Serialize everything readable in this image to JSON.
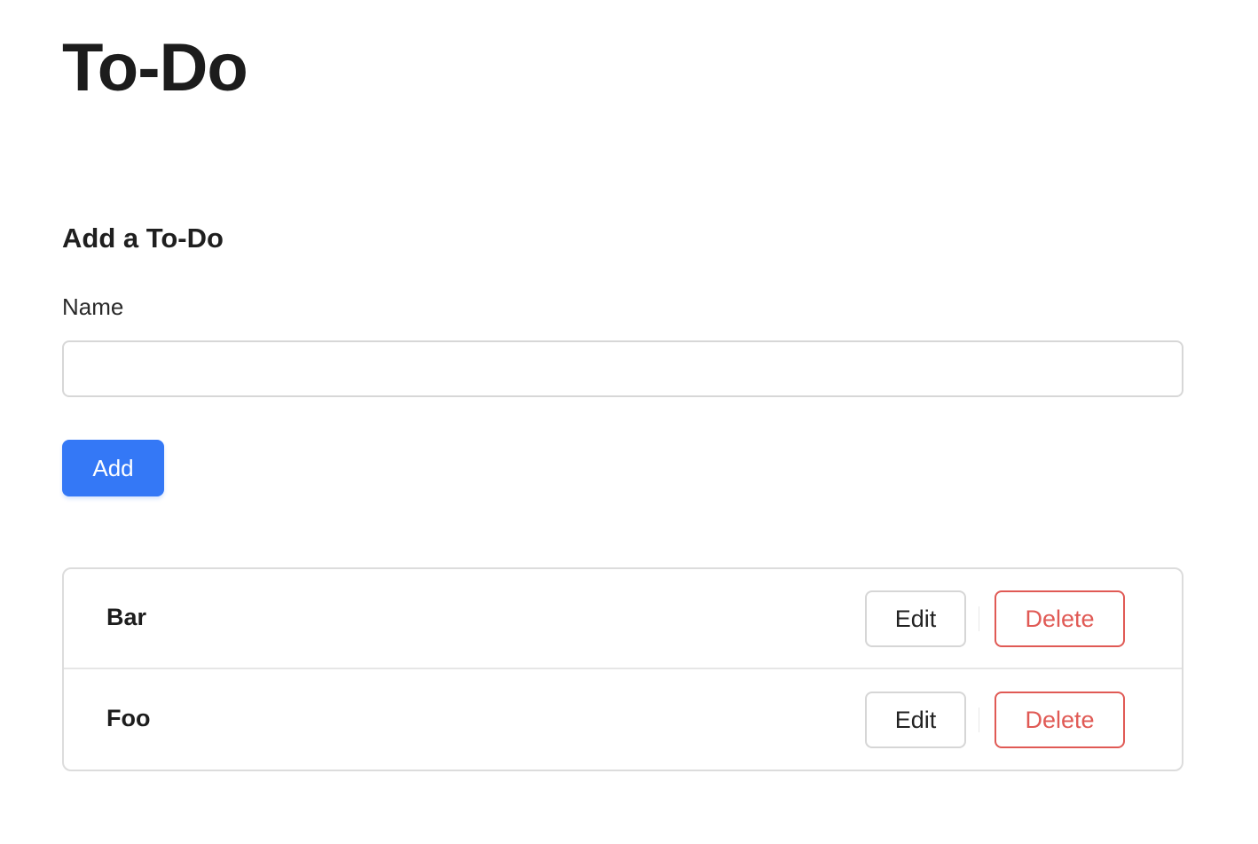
{
  "header": {
    "title": "To-Do"
  },
  "form": {
    "title": "Add a To-Do",
    "name_label": "Name",
    "name_value": "",
    "name_placeholder": "",
    "add_label": "Add"
  },
  "todos": [
    {
      "name": "Bar",
      "edit_label": "Edit",
      "delete_label": "Delete"
    },
    {
      "name": "Foo",
      "edit_label": "Edit",
      "delete_label": "Delete"
    }
  ],
  "colors": {
    "primary": "#3478f6",
    "danger": "#e05a55",
    "border": "#d7d7d7",
    "text": "#1f1f1f"
  }
}
